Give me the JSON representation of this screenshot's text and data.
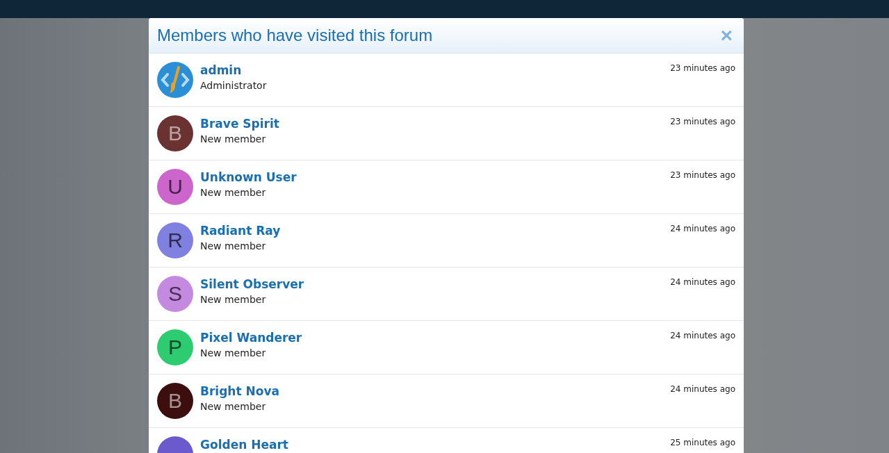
{
  "dialog": {
    "title": "Members who have visited this forum",
    "close": "×"
  },
  "members": [
    {
      "name": "admin",
      "role": "Administrator",
      "time": "23 minutes ago",
      "kind": "logo"
    },
    {
      "name": "Brave Spirit",
      "role": "New member",
      "time": "23 minutes ago",
      "kind": "letter",
      "letter": "B",
      "color": "#6b3232"
    },
    {
      "name": "Unknown User",
      "role": "New member",
      "time": "23 minutes ago",
      "kind": "letter",
      "letter": "U",
      "color": "#cc66cc"
    },
    {
      "name": "Radiant Ray",
      "role": "New member",
      "time": "24 minutes ago",
      "kind": "letter",
      "letter": "R",
      "color": "#8080e0"
    },
    {
      "name": "Silent Observer",
      "role": "New member",
      "time": "24 minutes ago",
      "kind": "letter",
      "letter": "S",
      "color": "#c48ae0"
    },
    {
      "name": "Pixel Wanderer",
      "role": "New member",
      "time": "24 minutes ago",
      "kind": "letter",
      "letter": "P",
      "color": "#2ecc71"
    },
    {
      "name": "Bright Nova",
      "role": "New member",
      "time": "24 minutes ago",
      "kind": "letter",
      "letter": "B",
      "color": "#3d0e0e"
    },
    {
      "name": "Golden Heart",
      "time": "25 minutes ago",
      "kind": "letter",
      "color": "#6a5acd"
    }
  ]
}
